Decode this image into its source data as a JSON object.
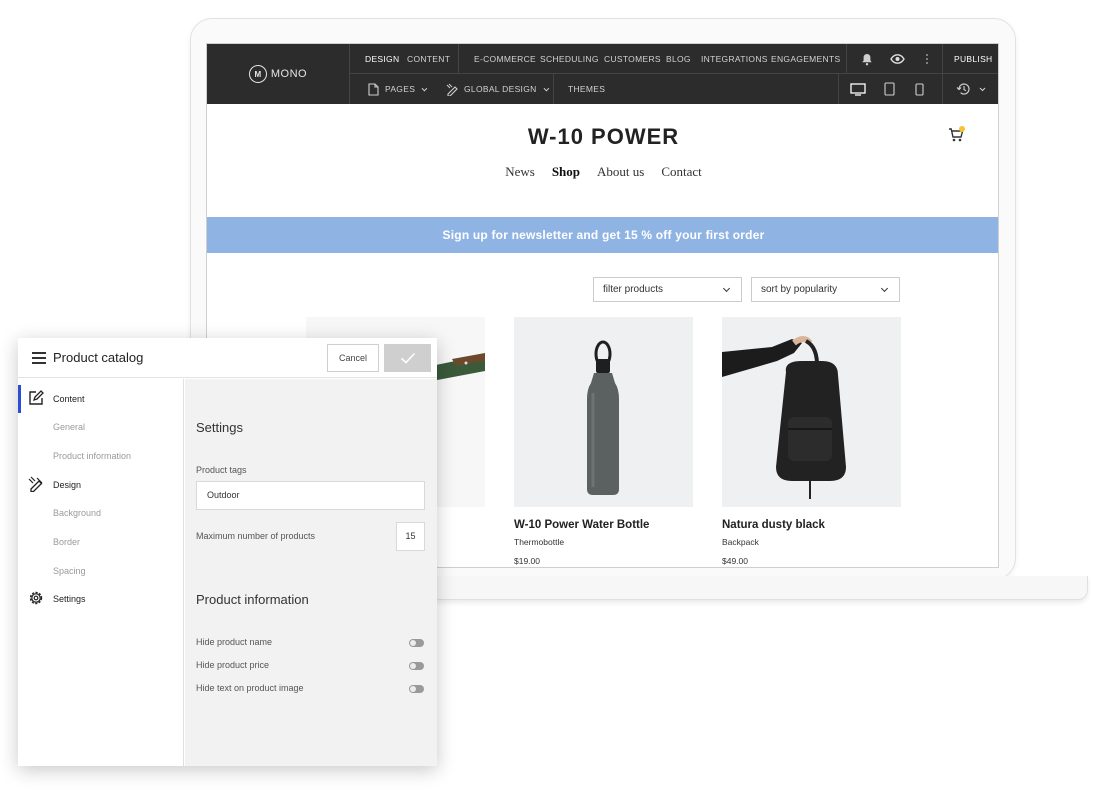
{
  "editor": {
    "logo": "MONO",
    "logo_mark": "M",
    "top_tabs": [
      "DESIGN",
      "CONTENT"
    ],
    "top_menu": [
      "E-COMMERCE",
      "SCHEDULING",
      "CUSTOMERS",
      "BLOG",
      "INTEGRATIONS",
      "ENGAGEMENTS"
    ],
    "publish": "PUBLISH",
    "pages": "PAGES",
    "global_design": "GLOBAL DESIGN",
    "themes": "THEMES"
  },
  "site": {
    "title": "W-10 POWER",
    "nav": [
      "News",
      "Shop",
      "About us",
      "Contact"
    ],
    "banner": "Sign up for newsletter and get 15 % off your first order",
    "filter": "filter products",
    "sort": "sort by popularity",
    "products": [
      {
        "name": "W-10 Power Water Bottle",
        "type": "Thermobottle",
        "price": "$19.00"
      },
      {
        "name": "Natura dusty black",
        "type": "Backpack",
        "price": "$49.00"
      }
    ]
  },
  "panel": {
    "title": "Product catalog",
    "cancel": "Cancel",
    "sidebar": {
      "content": "Content",
      "general": "General",
      "product_information": "Product information",
      "design": "Design",
      "background": "Background",
      "border": "Border",
      "spacing": "Spacing",
      "settings": "Settings"
    },
    "settings_heading": "Settings",
    "product_tags_label": "Product tags",
    "product_tags_value": "Outdoor",
    "max_products_label": "Maximum number of products",
    "max_products_value": "15",
    "product_info_heading": "Product information",
    "toggles": [
      "Hide product name",
      "Hide product price",
      "Hide text on product image"
    ]
  },
  "colors": {
    "toolbar": "#2c2c2c",
    "banner": "#8fb4e3",
    "accent": "#2a4fd6",
    "cart_badge": "#f4c430"
  }
}
